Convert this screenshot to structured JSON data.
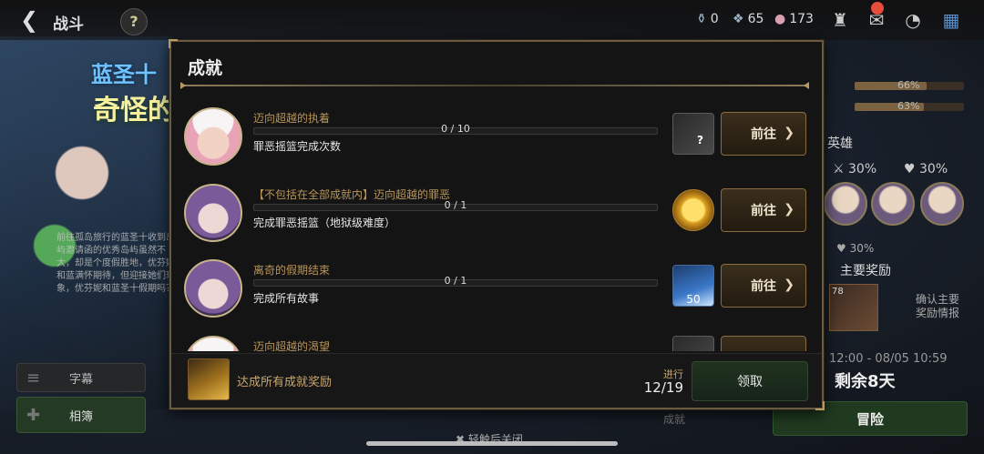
{
  "topbar": {
    "title": "战斗",
    "help": "?",
    "resources": [
      {
        "icon": "potion-icon",
        "value": "0"
      },
      {
        "icon": "crystal-cluster-icon",
        "value": "65"
      },
      {
        "icon": "gem-icon",
        "value": "173"
      }
    ]
  },
  "background": {
    "event_title_1": "蓝圣十",
    "event_title_2": "奇怪的",
    "story_text": "前往孤岛旅行的蓝圣十收到岛屿邀请函的优秀岛屿虽然不大，却是个度假胜地，优芬妮和蓝满怀期待，但迎接她们现象，优芬妮和蓝圣十假期吗？",
    "side_button_1": "字幕",
    "side_button_2": "相簿",
    "bars": [
      {
        "pct_label": "66%",
        "value": 0.66
      },
      {
        "pct_label": "63%",
        "value": 0.63
      }
    ],
    "heroes_label": "英雄",
    "stat_attack": "30%",
    "stat_hp": "30%",
    "stat_other": "30%",
    "main_reward_label": "主要奖励",
    "reward_count": "78",
    "confirm_text_1": "确认主要",
    "confirm_text_2": "奖励情报",
    "date_range": "12:00 - 08/05 10:59",
    "remaining": "剩余8天",
    "adventure": "冒险",
    "achievement_tab": "成就"
  },
  "modal": {
    "title": "成就",
    "achievements": [
      {
        "title": "迈向超越的执着",
        "progress_text": "0 / 10",
        "progress": 0,
        "description": "罪恶摇篮完成次数",
        "reward_icon": "mystery-box-icon",
        "reward_qty": "",
        "button": "前往",
        "avatar": "pink"
      },
      {
        "title": "【不包括在全部成就内】迈向超越的罪恶",
        "progress_text": "0 / 1",
        "progress": 0,
        "description": "完成罪恶摇篮（地狱级难度）",
        "reward_icon": "gold-coin-icon",
        "reward_qty": "",
        "button": "前往",
        "avatar": "purple"
      },
      {
        "title": "离奇的假期结束",
        "progress_text": "0 / 1",
        "progress": 0,
        "description": "完成所有故事",
        "reward_icon": "crystal-icon",
        "reward_qty": "50",
        "button": "前往",
        "avatar": "purple"
      },
      {
        "title": "迈向超越的渴望",
        "progress_text": "",
        "progress": 0,
        "description": "",
        "reward_icon": "reward-icon",
        "reward_qty": "",
        "button": "",
        "avatar": "pink"
      }
    ],
    "footer": {
      "label": "达成所有成就奖励",
      "progress_label": "进行",
      "progress_value": "12/19",
      "claim": "领取"
    }
  },
  "close_hint": "轻触后关闭"
}
